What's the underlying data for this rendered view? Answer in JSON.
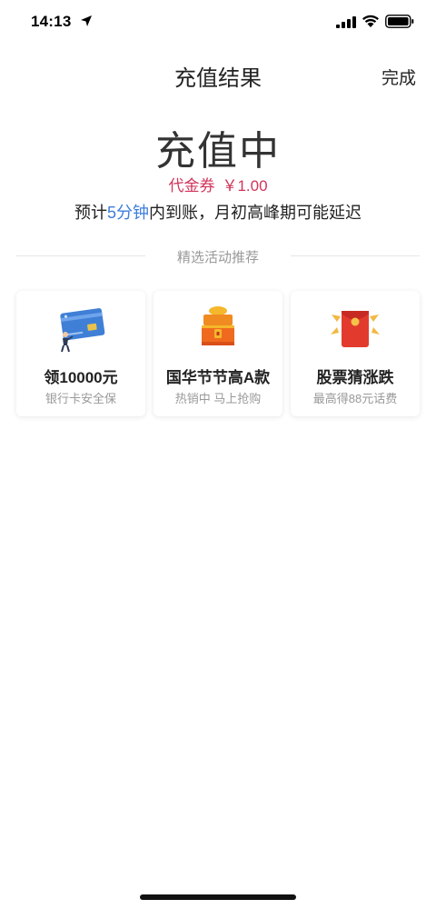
{
  "status_bar": {
    "time": "14:13"
  },
  "nav": {
    "title": "充值结果",
    "done_label": "完成"
  },
  "status": {
    "title": "充值中",
    "voucher_label": "代金券",
    "voucher_amount": "￥1.00",
    "eta_prefix": "预计",
    "eta_highlight": "5分钟",
    "eta_suffix": "内到账，月初高峰期可能延迟"
  },
  "section": {
    "label": "精选活动推荐"
  },
  "cards": [
    {
      "title": "领10000元",
      "subtitle": "银行卡安全保",
      "icon": "bank-card-icon"
    },
    {
      "title": "国华节节高A款",
      "subtitle": "热销中 马上抢购",
      "icon": "treasure-chest-icon"
    },
    {
      "title": "股票猜涨跌",
      "subtitle": "最高得88元话费",
      "icon": "red-envelope-icon"
    }
  ],
  "colors": {
    "accent_blue": "#3b7ddd",
    "voucher_red": "#d1345a"
  }
}
